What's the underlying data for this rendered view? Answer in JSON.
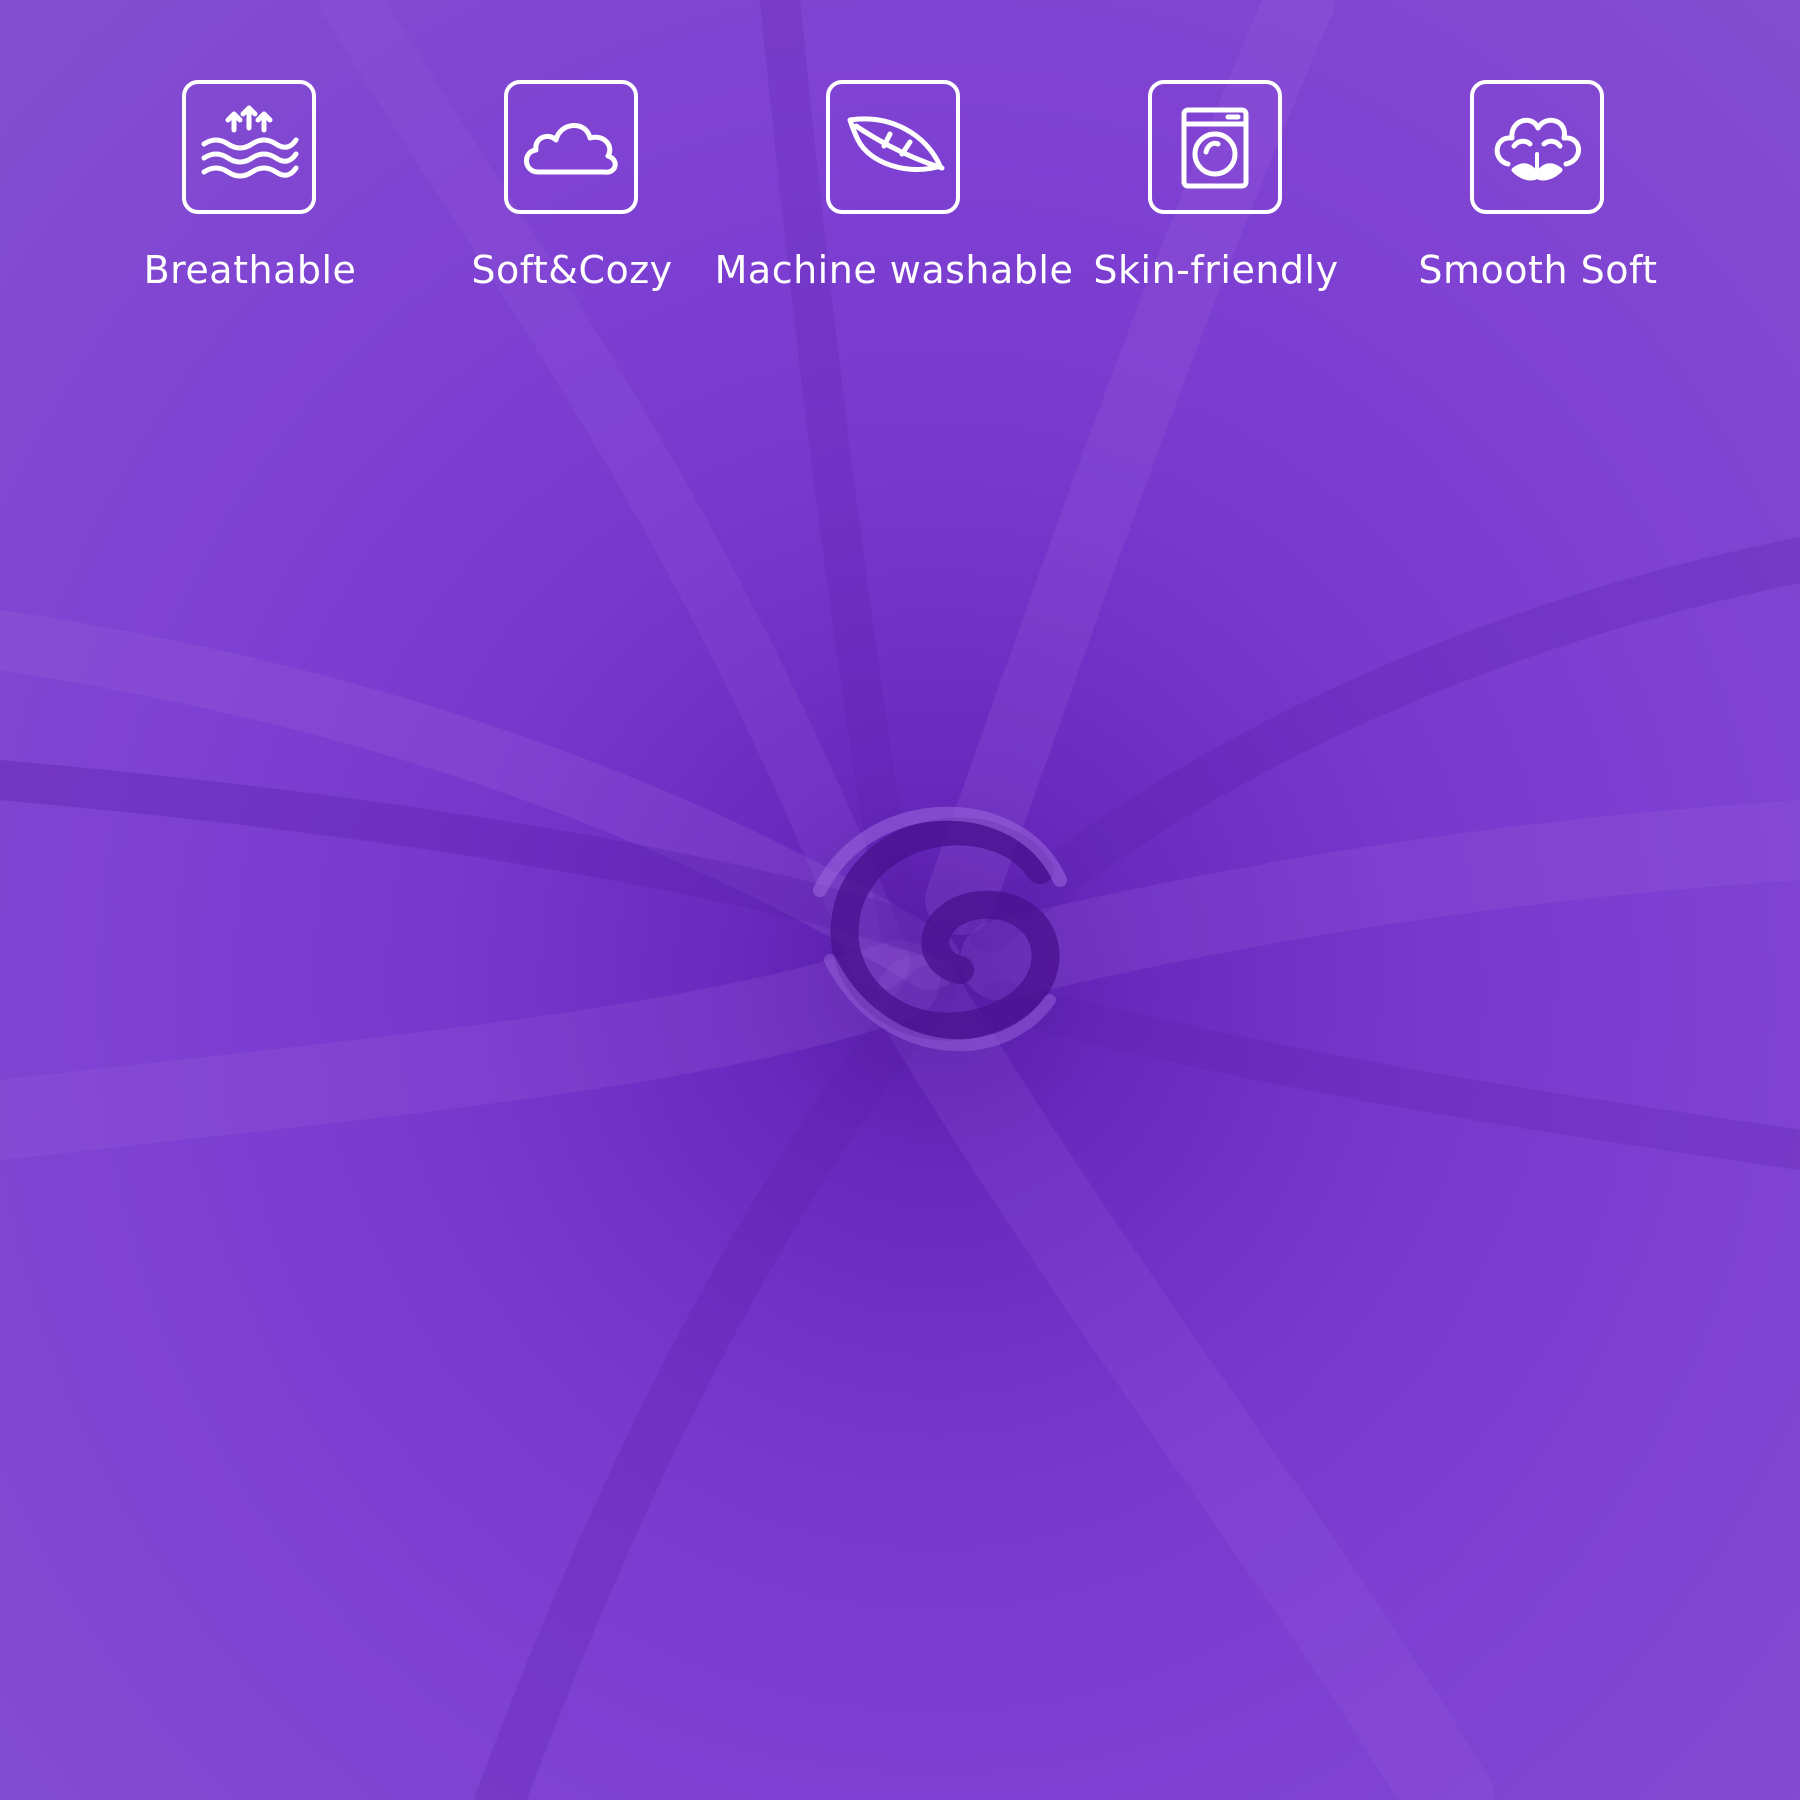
{
  "colors": {
    "fabric_base": "#7a3ad0",
    "fabric_shadow": "#5a1fa8",
    "fabric_highlight": "#9a62dc",
    "icon_foreground": "#ffffff"
  },
  "features": [
    {
      "label": "Breathable",
      "icon": "breathable-waves-arrows-icon"
    },
    {
      "label": "Soft&Cozy",
      "icon": "cloud-icon"
    },
    {
      "label": "Machine washable",
      "icon": "leaf-icon"
    },
    {
      "label": "Skin-friendly",
      "icon": "washing-machine-icon"
    },
    {
      "label": "Smooth Soft",
      "icon": "cotton-flower-icon"
    }
  ]
}
